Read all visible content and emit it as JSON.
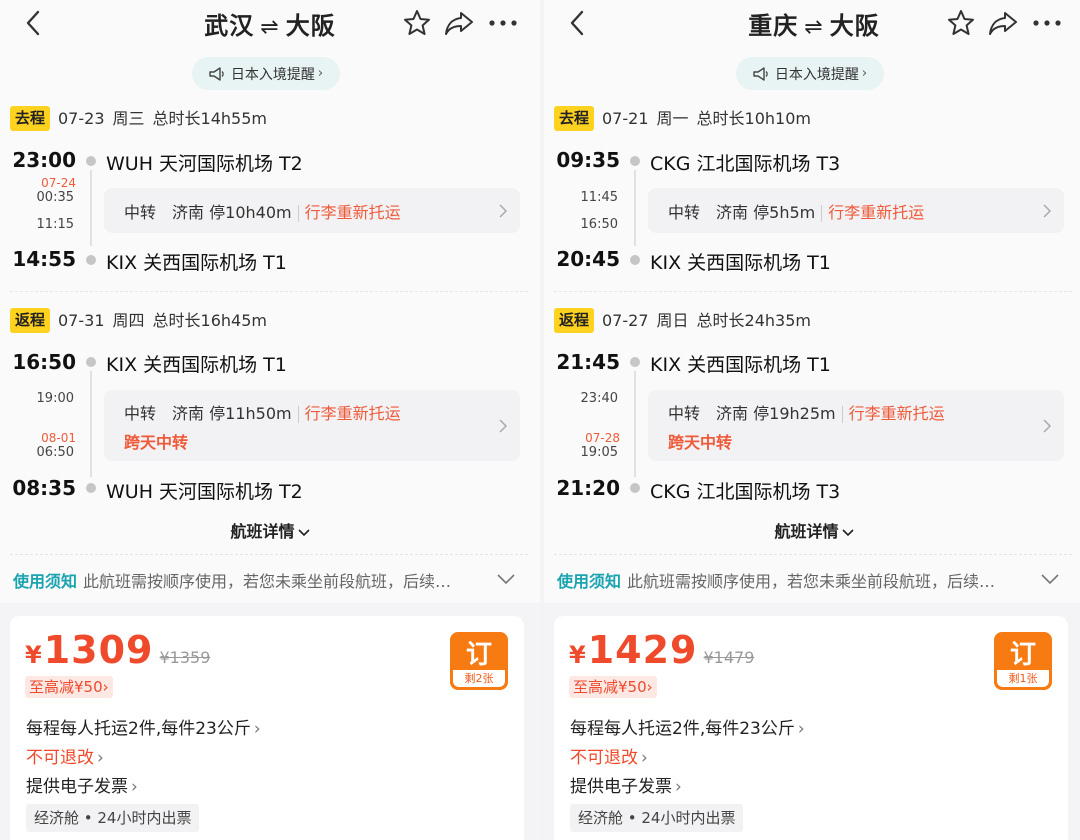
{
  "left": {
    "title_from": "武汉",
    "title_arrow": "⇌",
    "title_to": "大阪",
    "notice": "日本入境提醒",
    "outbound": {
      "tag": "去程",
      "date": "07-23",
      "weekday": "周三",
      "duration": "总时长14h55m",
      "dep_time": "23:00",
      "dep_airport": "WUH 天河国际机场 T2",
      "arr_time": "14:55",
      "arr_airport": "KIX 关西国际机场 T1",
      "mid_date": "07-24",
      "mid_arr": "00:35",
      "mid_dep": "11:15",
      "transfer_label": "中转",
      "transfer_city": "济南",
      "transfer_stop": "停10h40m",
      "transfer_note": "行李重新托运",
      "transfer_extra": ""
    },
    "return": {
      "tag": "返程",
      "date": "07-31",
      "weekday": "周四",
      "duration": "总时长16h45m",
      "dep_time": "16:50",
      "dep_airport": "KIX 关西国际机场 T1",
      "arr_time": "08:35",
      "arr_airport": "WUH 天河国际机场 T2",
      "mid_arr": "19:00",
      "mid_date2": "08-01",
      "mid_dep": "06:50",
      "transfer_label": "中转",
      "transfer_city": "济南",
      "transfer_stop": "停11h50m",
      "transfer_note": "行李重新托运",
      "transfer_extra": "跨天中转"
    },
    "details": "航班详情",
    "usage_title": "使用须知",
    "usage_text": "此航班需按顺序使用，若您未乘坐前段航班，后续…",
    "price": "1309",
    "orig_price": "¥1359",
    "yen": "¥",
    "discount": "至高减¥50",
    "book": "订",
    "left_tickets": "剩2张",
    "baggage": "每程每人托运2件,每件23公斤",
    "refund": "不可退改",
    "invoice": "提供电子发票",
    "cabin": "经济舱 • 24小时内出票"
  },
  "right": {
    "title_from": "重庆",
    "title_arrow": "⇌",
    "title_to": "大阪",
    "notice": "日本入境提醒",
    "outbound": {
      "tag": "去程",
      "date": "07-21",
      "weekday": "周一",
      "duration": "总时长10h10m",
      "dep_time": "09:35",
      "dep_airport": "CKG 江北国际机场 T3",
      "arr_time": "20:45",
      "arr_airport": "KIX 关西国际机场 T1",
      "mid_date": "",
      "mid_arr": "11:45",
      "mid_dep": "16:50",
      "transfer_label": "中转",
      "transfer_city": "济南",
      "transfer_stop": "停5h5m",
      "transfer_note": "行李重新托运",
      "transfer_extra": ""
    },
    "return": {
      "tag": "返程",
      "date": "07-27",
      "weekday": "周日",
      "duration": "总时长24h35m",
      "dep_time": "21:45",
      "dep_airport": "KIX 关西国际机场 T1",
      "arr_time": "21:20",
      "arr_airport": "CKG 江北国际机场 T3",
      "mid_arr": "23:40",
      "mid_date2": "07-28",
      "mid_dep": "19:05",
      "transfer_label": "中转",
      "transfer_city": "济南",
      "transfer_stop": "停19h25m",
      "transfer_note": "行李重新托运",
      "transfer_extra": "跨天中转"
    },
    "details": "航班详情",
    "usage_title": "使用须知",
    "usage_text": "此航班需按顺序使用，若您未乘坐前段航班，后续…",
    "price": "1429",
    "orig_price": "¥1479",
    "yen": "¥",
    "discount": "至高减¥50",
    "book": "订",
    "left_tickets": "剩1张",
    "baggage": "每程每人托运2件,每件23公斤",
    "refund": "不可退改",
    "invoice": "提供电子发票",
    "cabin": "经济舱 • 24小时内出票"
  },
  "icons": {
    "back": "back-arrow-icon",
    "favorite": "star-icon",
    "share": "share-icon",
    "more": "more-dots-icon",
    "notice": "megaphone-icon"
  },
  "colors": {
    "accent_red": "#ef4a2b",
    "tag_yellow": "#ffd21f",
    "teal": "#1aa3b0",
    "book_orange": "#f77a12"
  }
}
